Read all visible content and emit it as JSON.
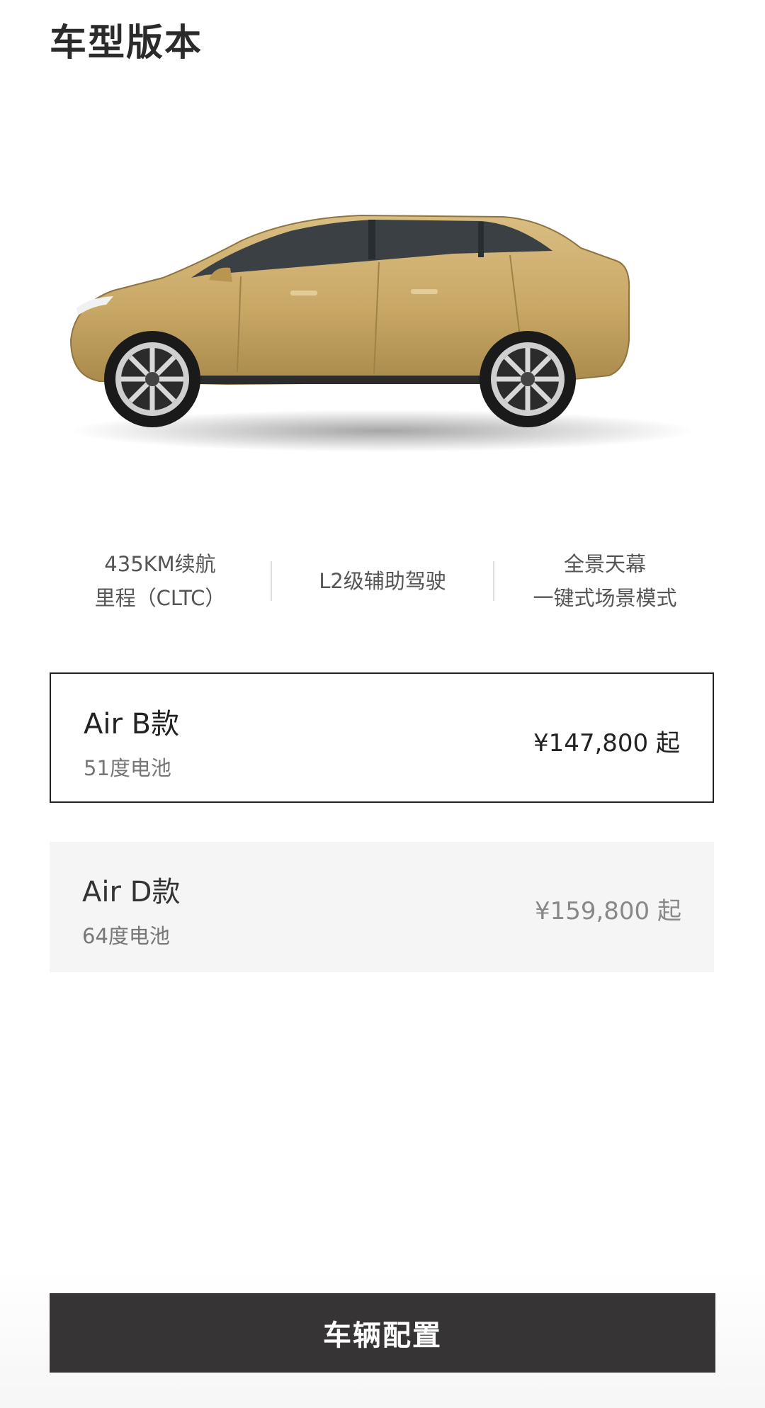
{
  "header": {
    "title": "车型版本"
  },
  "car": {
    "color": "#C9A866"
  },
  "features": [
    {
      "line1": "435KM续航",
      "line2": "里程（CLTC）"
    },
    {
      "line1": "L2级辅助驾驶",
      "line2": ""
    },
    {
      "line1": "全景天幕",
      "line2": "一键式场景模式"
    }
  ],
  "models": [
    {
      "name": "Air B款",
      "battery": "51度电池",
      "price": "¥147,800 起",
      "selected": true
    },
    {
      "name": "Air D款",
      "battery": "64度电池",
      "price": "¥159,800 起",
      "selected": false
    }
  ],
  "footer": {
    "button_label": "车辆配置"
  },
  "colors": {
    "button_bg": "#363434",
    "selected_border": "#222222",
    "unselected_bg": "#F5F5F5"
  }
}
